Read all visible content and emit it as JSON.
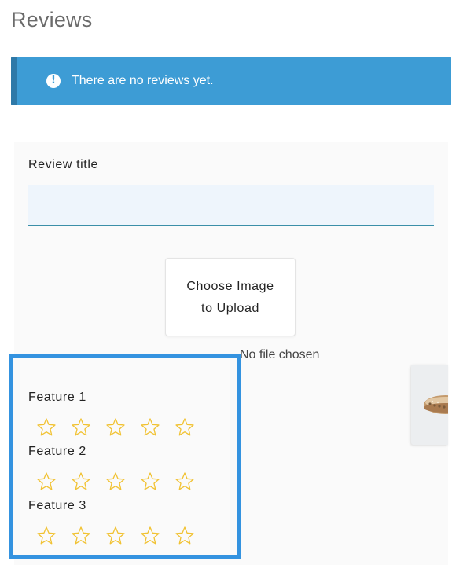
{
  "heading": "Reviews",
  "notice": {
    "icon": "exclamation-circle-icon",
    "text": "There are no reviews yet.",
    "color": "#3d9cd5"
  },
  "form": {
    "review_title_label": "Review title",
    "review_title_value": "",
    "upload": {
      "line1": "Choose Image",
      "line2": "to Upload"
    },
    "file_status": "No file chosen"
  },
  "features": [
    {
      "label": "Feature 1",
      "rating": 0,
      "max": 5
    },
    {
      "label": "Feature 2",
      "rating": 0,
      "max": 5
    },
    {
      "label": "Feature 3",
      "rating": 0,
      "max": 5
    }
  ],
  "colors": {
    "star_outline": "#f1c232",
    "highlight_border": "#3493e0"
  }
}
